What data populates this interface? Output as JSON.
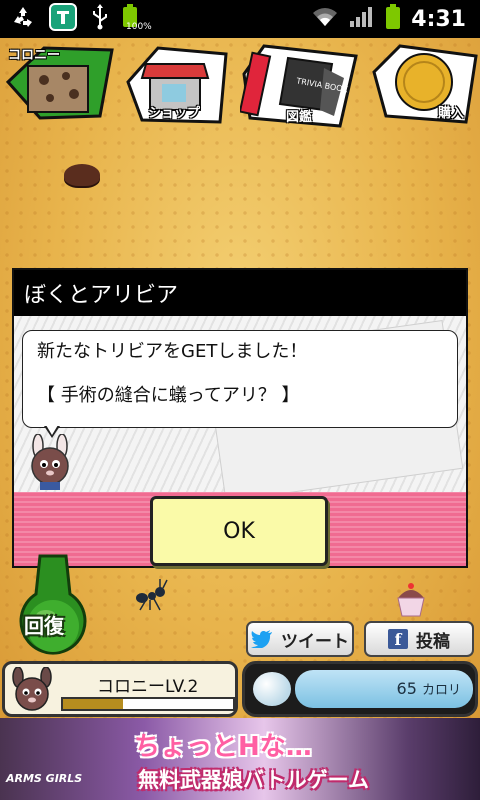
{
  "statusbar": {
    "battery_percent": "100%",
    "time": "4:31"
  },
  "menu": {
    "colony": "コロニー",
    "shop": "ショップ",
    "zukan": "図鑑",
    "purchase": "購入",
    "trivia_book_text": "TRIVIA BOOK"
  },
  "dialog": {
    "title": "ぼくとアリビア",
    "message_line1": "新たなトリビアをGETしました！",
    "message_line2": "【 手術の縫合に蟻ってアリ？ 】",
    "ok_label": "OK"
  },
  "controls": {
    "heal_label": "回復",
    "tweet_label": "ツイート",
    "post_label": "投稿"
  },
  "colony_status": {
    "level_text": "コロニーLV.2",
    "level_progress": 0.35
  },
  "calorie": {
    "value_text": "65",
    "unit": "カロリ"
  },
  "ad": {
    "line1": "ちょっとHな…",
    "line2": "無料武器娘バトルゲーム",
    "logo": "ARMS GIRLS"
  },
  "colors": {
    "dialog_footer": "#f06b91",
    "ok_button": "#fafaa8",
    "background": "#e9b64e",
    "facebook": "#3b5998",
    "twitter": "#1da1f2"
  }
}
